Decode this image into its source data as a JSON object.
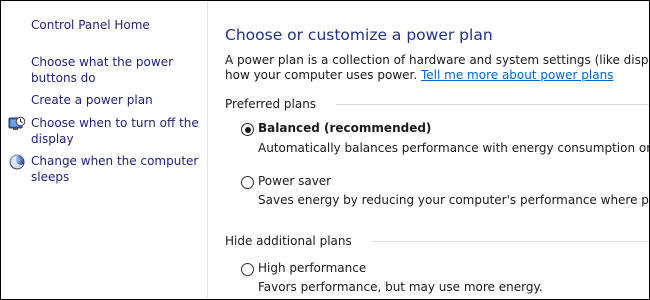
{
  "sidebar": {
    "items": [
      {
        "label": "Control Panel Home",
        "icon": null
      },
      {
        "label_lines": [
          "Choose what the power",
          "buttons do"
        ],
        "icon": null
      },
      {
        "label": "Create a power plan",
        "icon": null
      },
      {
        "label_lines": [
          "Choose when to turn off the",
          "display"
        ],
        "icon": "display-timer-icon"
      },
      {
        "label_lines": [
          "Change when the computer",
          "sleeps"
        ],
        "icon": "sleep-moon-icon"
      }
    ]
  },
  "main": {
    "title": "Choose or customize a power plan",
    "description_line1": "A power plan is a collection of hardware and system settings (like display brightn",
    "description_line2": "how your computer uses power.",
    "learn_more_link": "Tell me more about power plans",
    "preferred_header": "Preferred plans",
    "hidden_header": "Hide additional plans",
    "plans": [
      {
        "name": "Balanced (recommended)",
        "description": "Automatically balances performance with energy consumption on capable",
        "selected": true,
        "bold": true
      },
      {
        "name": "Power saver",
        "description": "Saves energy by reducing your computer's performance where possible.",
        "selected": false,
        "bold": false
      },
      {
        "name": "High performance",
        "description": "Favors performance, but may use more energy.",
        "selected": false,
        "bold": false
      }
    ]
  },
  "colors": {
    "title": "#1e3287",
    "nav_link": "#1f1f7a",
    "hyperlink": "#0066cc",
    "text": "#1a1a1a"
  }
}
